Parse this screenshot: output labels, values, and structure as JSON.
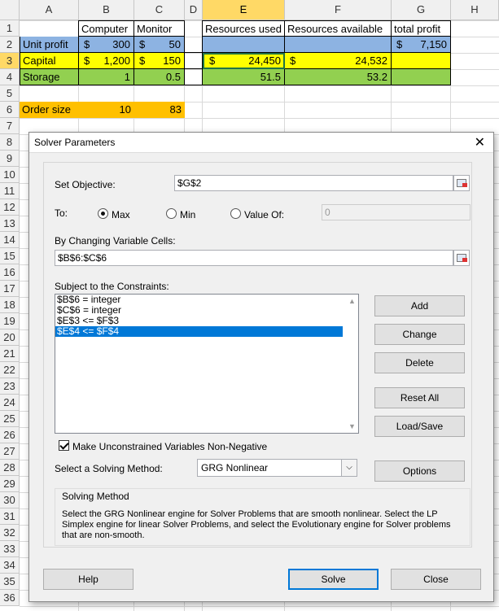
{
  "spreadsheet": {
    "columns": [
      "A",
      "B",
      "C",
      "D",
      "E",
      "F",
      "G",
      "H"
    ],
    "rows": [
      "1",
      "2",
      "3",
      "4",
      "5",
      "6",
      "7",
      "8",
      "9",
      "10",
      "11",
      "12",
      "13",
      "14",
      "15",
      "16",
      "17",
      "18",
      "19",
      "20",
      "21",
      "22",
      "23",
      "24",
      "25",
      "26",
      "27",
      "28",
      "29",
      "30",
      "31",
      "32",
      "33",
      "34",
      "35",
      "36"
    ],
    "cells": {
      "b1": "Computer",
      "c1": "Monitor",
      "e1": "Resources used",
      "f1": "Resources available",
      "g1": "total profit",
      "a2": "Unit profit",
      "b2_cur": "$",
      "b2": "300",
      "c2_cur": "$",
      "c2": "50",
      "g2_cur": "$",
      "g2": "7,150",
      "a3": "Capital",
      "b3_cur": "$",
      "b3": "1,200",
      "c3_cur": "$",
      "c3": "150",
      "e3_cur": "$",
      "e3": "24,450",
      "f3_cur": "$",
      "f3": "24,532",
      "a4": "Storage",
      "b4": "1",
      "c4": "0.5",
      "e4": "51.5",
      "f4": "53.2",
      "a6": "Order size",
      "b6": "10",
      "c6": "83"
    }
  },
  "dialog": {
    "title": "Solver Parameters",
    "close_glyph": "✕",
    "set_objective_label": "Set Objective:",
    "set_objective_value": "$G$2",
    "to_label": "To:",
    "opt_max": "Max",
    "opt_min": "Min",
    "opt_value_of": "Value Of:",
    "value_of_value": "0",
    "by_changing_label": "By Changing Variable Cells:",
    "by_changing_value": "$B$6:$C$6",
    "constraints_label": "Subject to the Constraints:",
    "constraints": [
      "$B$6 = integer",
      "$C$6 = integer",
      "$E$3 <= $F$3",
      "$E$4 <= $F$4"
    ],
    "btn_add": "Add",
    "btn_change": "Change",
    "btn_delete": "Delete",
    "btn_reset": "Reset All",
    "btn_load": "Load/Save",
    "make_nonneg_label": "Make Unconstrained Variables Non-Negative",
    "method_label": "Select a Solving Method:",
    "method_value": "GRG Nonlinear",
    "btn_options": "Options",
    "solving_method_title": "Solving Method",
    "solving_method_desc": "Select the GRG Nonlinear engine for Solver Problems that are smooth nonlinear. Select the LP Simplex engine for linear Solver Problems, and select the Evolutionary engine for Solver problems that are non-smooth.",
    "btn_help": "Help",
    "btn_solve": "Solve",
    "btn_close": "Close"
  },
  "colors": {
    "blue": "#8db3e2",
    "yellow": "#ffff00",
    "green": "#92d050",
    "orange": "#ffc000",
    "accent": "#0078d7"
  }
}
